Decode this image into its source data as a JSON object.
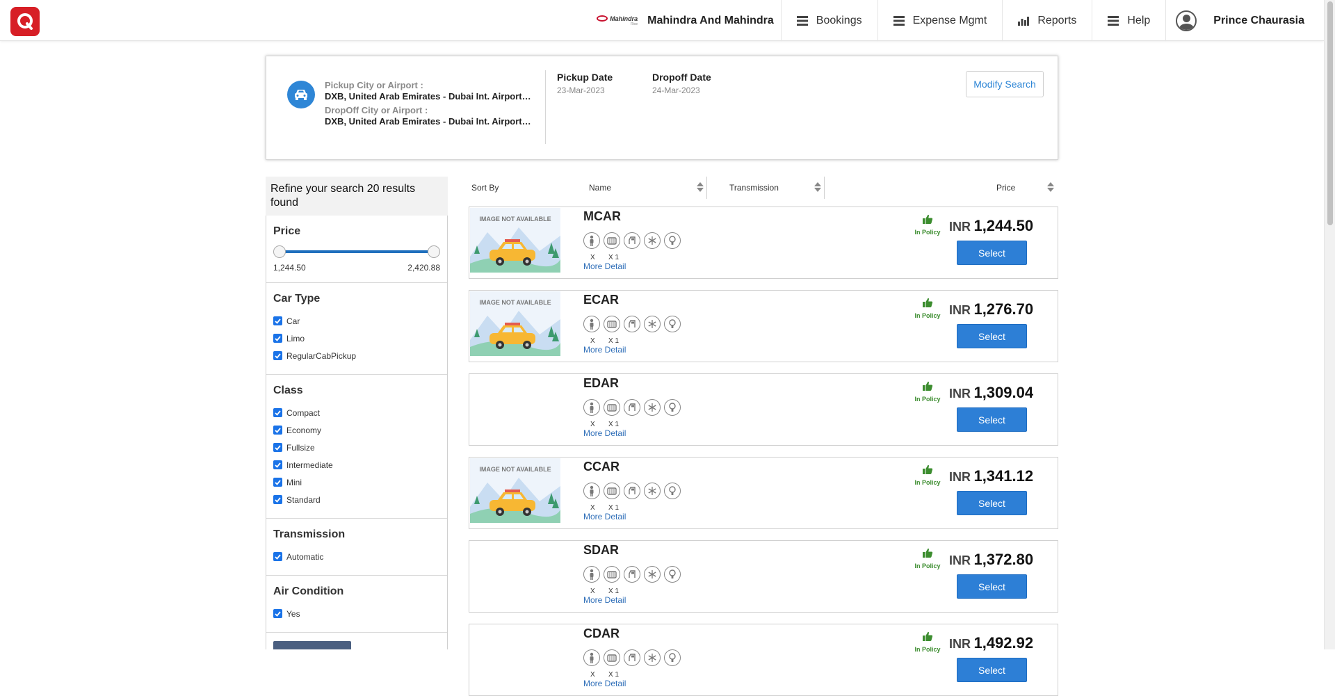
{
  "header": {
    "company_logo_word": "Mahindra",
    "company_logo_sub": "Rise",
    "company_name": "Mahindra And Mahindra",
    "nav": [
      {
        "label": "Bookings",
        "icon": "menu-icon"
      },
      {
        "label": "Expense Mgmt",
        "icon": "menu-icon"
      },
      {
        "label": "Reports",
        "icon": "bar-chart-icon"
      },
      {
        "label": "Help",
        "icon": "menu-icon"
      }
    ],
    "user_name": "Prince Chaurasia"
  },
  "search": {
    "pickup_label": "Pickup City or Airport :",
    "pickup_value": "DXB, United Arab Emirates - Dubai Int. Airport (DXB)",
    "dropoff_label": "DropOff City or Airport :",
    "dropoff_value": "DXB, United Arab Emirates - Dubai Int. Airport (DXB)",
    "pickup_date_label": "Pickup Date",
    "pickup_date": "23-Mar-2023",
    "dropoff_date_label": "Dropoff Date",
    "dropoff_date": "24-Mar-2023",
    "modify_label": "Modify Search"
  },
  "filters": {
    "heading": "Refine your search 20 results found",
    "price": {
      "title": "Price",
      "min": "1,244.50",
      "max": "2,420.88"
    },
    "car_type": {
      "title": "Car Type",
      "options": [
        "Car",
        "Limo",
        "RegularCabPickup"
      ]
    },
    "class": {
      "title": "Class",
      "options": [
        "Compact",
        "Economy",
        "Fullsize",
        "Intermediate",
        "Mini",
        "Standard"
      ]
    },
    "transmission": {
      "title": "Transmission",
      "options": [
        "Automatic"
      ]
    },
    "air_condition": {
      "title": "Air Condition",
      "options": [
        "Yes"
      ]
    }
  },
  "sort": {
    "sort_by": "Sort By",
    "name": "Name",
    "transmission": "Transmission",
    "price": "Price"
  },
  "results": [
    {
      "code": "MCAR",
      "has_image": true,
      "policy": "In Policy",
      "currency": "INR",
      "price": "1,244.50",
      "select": "Select",
      "more": "More Detail",
      "pax": "X",
      "bags": "X 1"
    },
    {
      "code": "ECAR",
      "has_image": true,
      "policy": "In Policy",
      "currency": "INR",
      "price": "1,276.70",
      "select": "Select",
      "more": "More Detail",
      "pax": "X",
      "bags": "X 1"
    },
    {
      "code": "EDAR",
      "has_image": false,
      "policy": "In Policy",
      "currency": "INR",
      "price": "1,309.04",
      "select": "Select",
      "more": "More Detail",
      "pax": "X",
      "bags": "X 1"
    },
    {
      "code": "CCAR",
      "has_image": true,
      "policy": "In Policy",
      "currency": "INR",
      "price": "1,341.12",
      "select": "Select",
      "more": "More Detail",
      "pax": "X",
      "bags": "X 1"
    },
    {
      "code": "SDAR",
      "has_image": false,
      "policy": "In Policy",
      "currency": "INR",
      "price": "1,372.80",
      "select": "Select",
      "more": "More Detail",
      "pax": "X",
      "bags": "X 1"
    },
    {
      "code": "CDAR",
      "has_image": false,
      "policy": "In Policy",
      "currency": "INR",
      "price": "1,492.92",
      "select": "Select",
      "more": "More Detail",
      "pax": "X",
      "bags": "X 1"
    }
  ],
  "image_placeholder_text": "IMAGE NOT AVAILABLE",
  "colors": {
    "brand_red": "#d71f26",
    "primary_blue": "#2d7fd6",
    "policy_green": "#3c8d2f"
  }
}
